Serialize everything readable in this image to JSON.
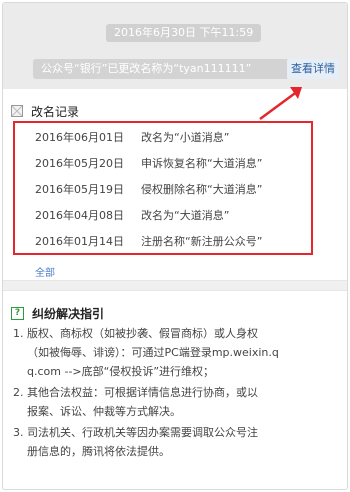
{
  "chat": {
    "timestamp": "2016年6月30日 下午11:59",
    "notice": "公众号“银行”已更改名称为“tyan111111”",
    "view_details": "查看详情"
  },
  "name_history": {
    "title": "改名记录",
    "records": [
      {
        "date": "2016年06月01日",
        "text": "改名为“小道消息”"
      },
      {
        "date": "2016年05月20日",
        "text": "申诉恢复名称“大道消息”"
      },
      {
        "date": "2016年05月19日",
        "text": "侵权删除名称“大道消息”"
      },
      {
        "date": "2016年04月08日",
        "text": "改名为“大道消息”"
      },
      {
        "date": "2016年01月14日",
        "text": "注册名称“新注册公众号”"
      }
    ],
    "all_link": "全部"
  },
  "dispute": {
    "title": "纠纷解决指引",
    "lines": [
      "1. 版权、商标权（如被抄袭、假冒商标）或人身权",
      "（如被侮辱、诽谤）：可通过PC端登录mp.weixin.q",
      "q.com -->底部“侵权投诉”进行维权；",
      "2. 其他合法权益：可根据详情信息进行协商，或以",
      "报案、诉讼、仲裁等方式解决。",
      "3. 司法机关、行政机关等因办案需要调取公众号注",
      "册信息的，腾讯将依法提供。"
    ]
  },
  "colors": {
    "highlight": "#e5262c",
    "link": "#4a7bc8",
    "guide_icon": "#2e9a3a"
  }
}
